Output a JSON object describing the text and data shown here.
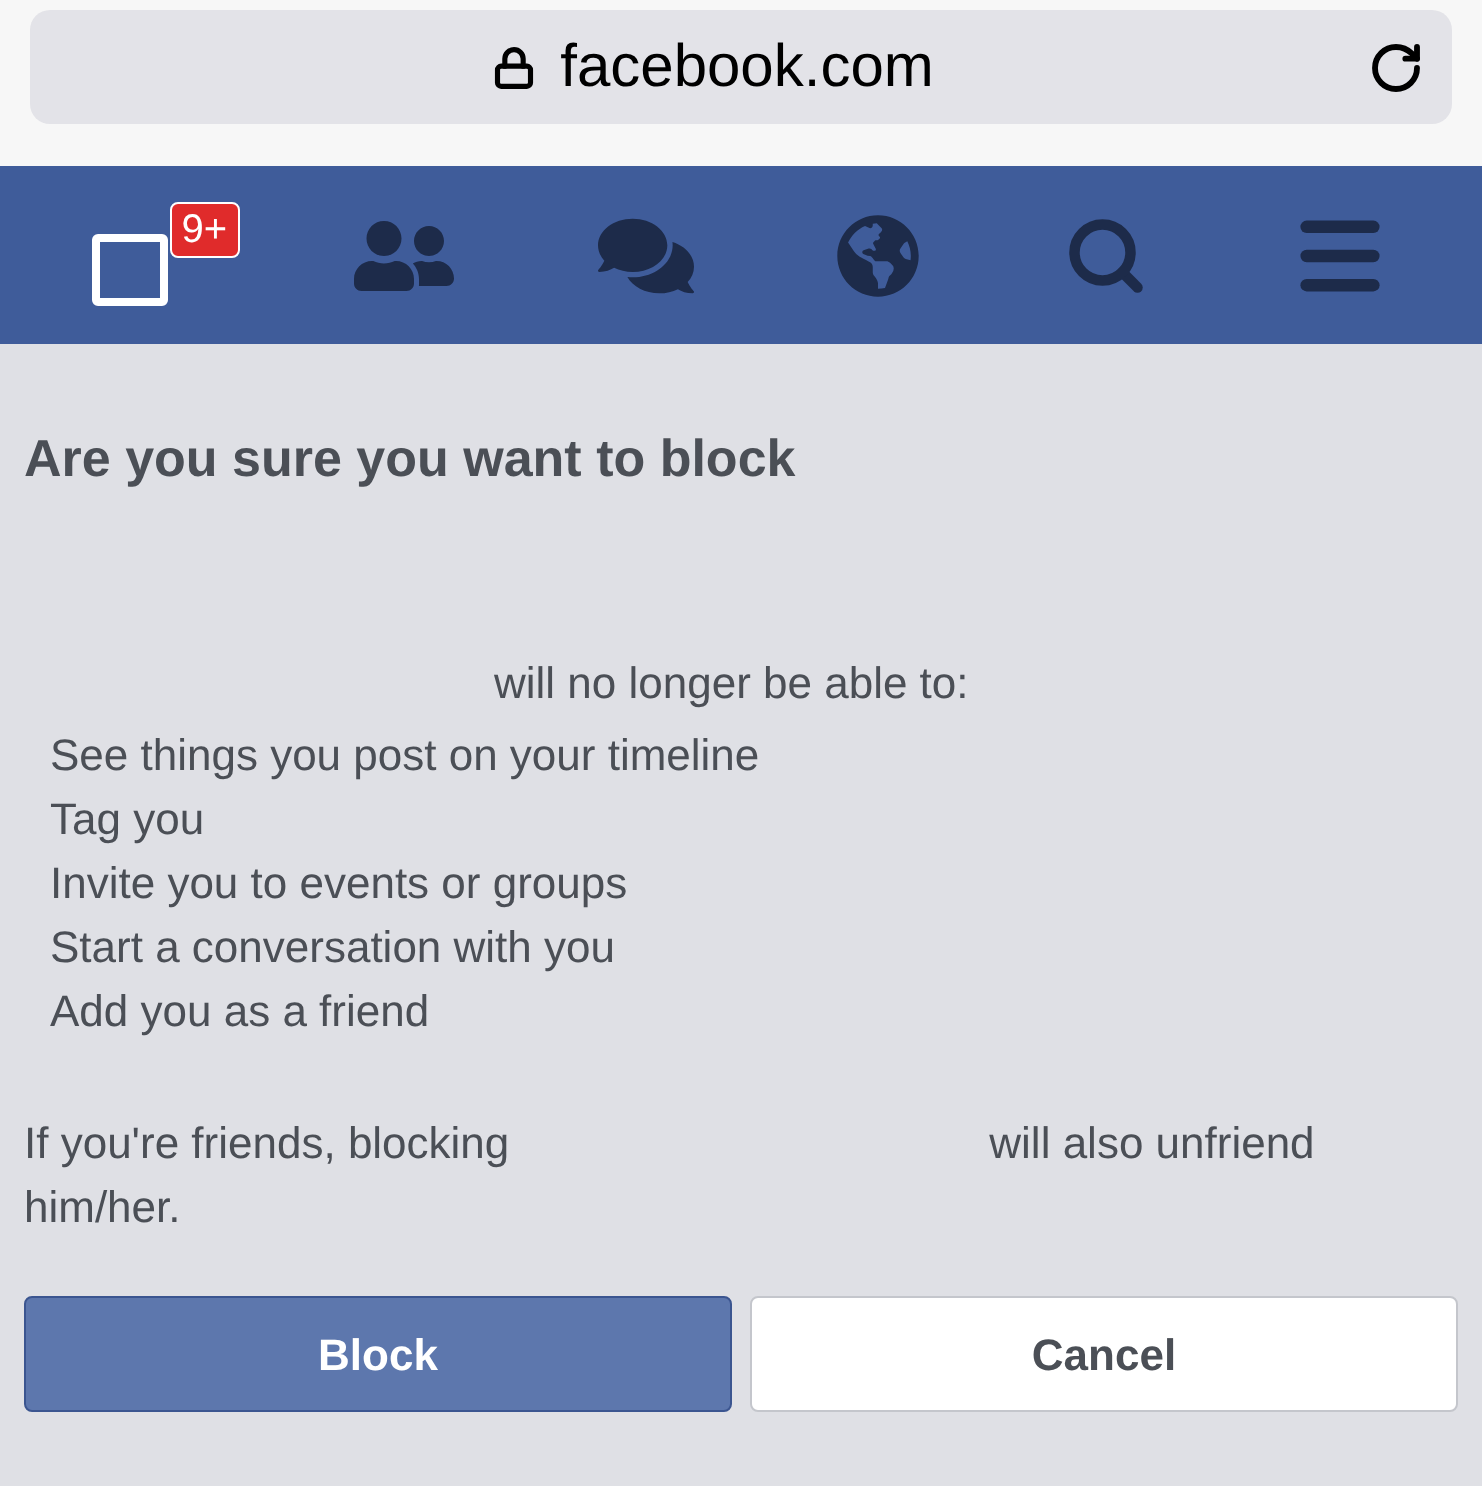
{
  "address_bar": {
    "url": "facebook.com"
  },
  "nav_bar": {
    "notifications_badge": "9+"
  },
  "dialog": {
    "title": "Are you sure you want to block",
    "lead": "will no longer be able to:",
    "restrictions": [
      "See things you post on your timeline",
      "Tag you",
      "Invite you to events or groups",
      "Start a conversation with you",
      "Add you as a friend"
    ],
    "note_before": "If you're friends, blocking",
    "note_after": "will also unfriend him/her.",
    "buttons": [
      {
        "label": "Block",
        "kind": "primary"
      },
      {
        "label": "Cancel",
        "kind": "secondary"
      }
    ]
  }
}
